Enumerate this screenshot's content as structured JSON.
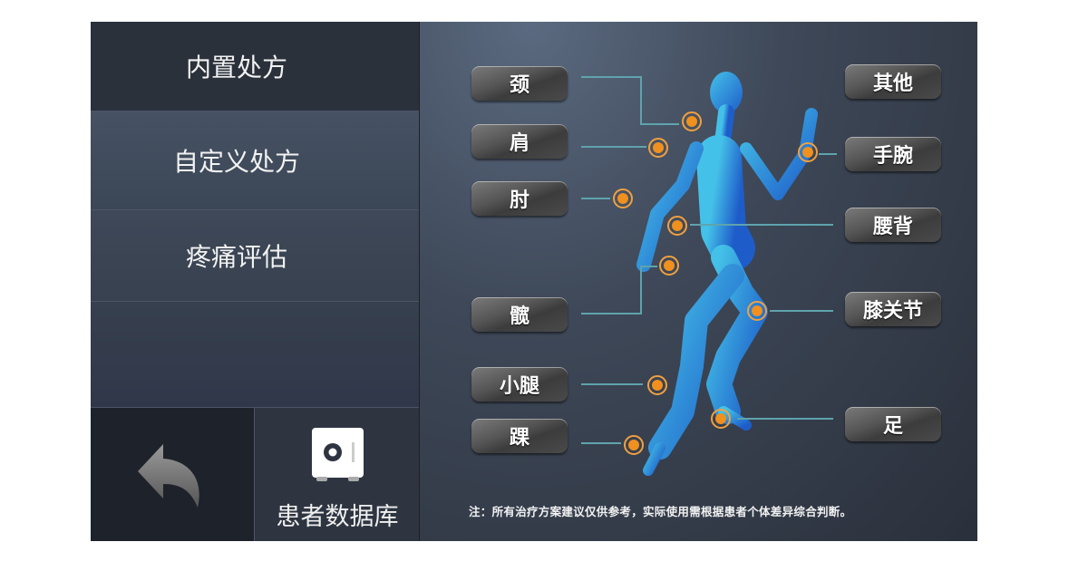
{
  "sidebar": {
    "items": [
      {
        "label": "内置处方"
      },
      {
        "label": "自定义处方"
      },
      {
        "label": "疼痛评估"
      }
    ],
    "back_icon": "back-arrow-icon",
    "database": {
      "label": "患者数据库",
      "icon": "safe-icon"
    }
  },
  "body_map": {
    "left_buttons": [
      {
        "label": "颈"
      },
      {
        "label": "肩"
      },
      {
        "label": "肘"
      },
      {
        "label": "髋"
      },
      {
        "label": "小腿"
      },
      {
        "label": "踝"
      }
    ],
    "right_buttons": [
      {
        "label": "其他"
      },
      {
        "label": "手腕"
      },
      {
        "label": "腰背"
      },
      {
        "label": "膝关节"
      },
      {
        "label": "足"
      }
    ],
    "note": "注：所有治疗方案建议仅供参考，实际使用需根据患者个体差异综合判断。"
  },
  "colors": {
    "accent_dot": "#f0901e",
    "line": "#5fa3ad",
    "figure": "#2aa8e0"
  }
}
